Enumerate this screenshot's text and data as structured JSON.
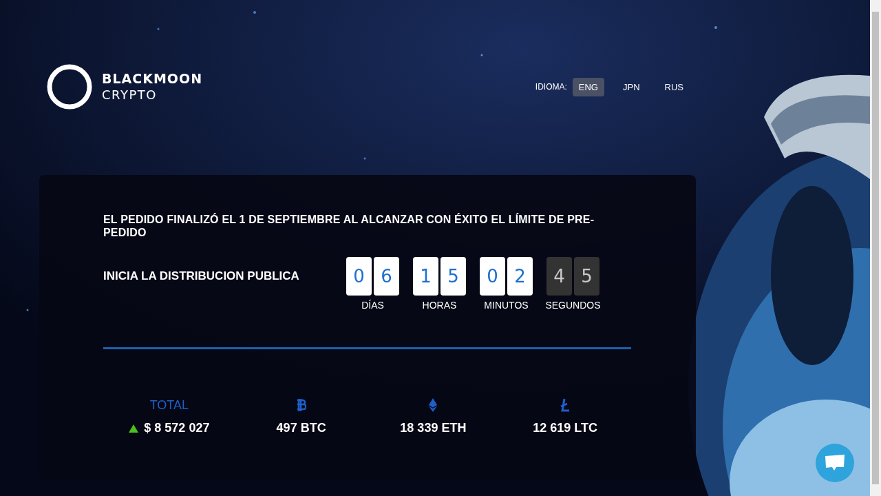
{
  "logo": {
    "line1": "BLACKMOON",
    "line2": "CRYPTO"
  },
  "language": {
    "label": "IDIOMA:",
    "options": [
      {
        "label": "ENG",
        "selected": true
      },
      {
        "label": "JPN",
        "selected": false
      },
      {
        "label": "RUS",
        "selected": false
      }
    ]
  },
  "notice": "EL PEDIDO FINALIZÓ EL 1 DE SEPTIEMBRE AL ALCANZAR CON ÉXITO EL LÍMITE DE PRE-PEDIDO",
  "countdown": {
    "label": "INICIA LA DISTRIBUCION PUBLICA",
    "units": [
      {
        "digits": [
          "0",
          "6"
        ],
        "label": "DÍAS",
        "kind": "light"
      },
      {
        "digits": [
          "1",
          "5"
        ],
        "label": "HORAS",
        "kind": "light"
      },
      {
        "digits": [
          "0",
          "2"
        ],
        "label": "MINUTOS",
        "kind": "light"
      },
      {
        "digits": [
          "4",
          "5"
        ],
        "label": "SEGUNDOS",
        "kind": "dark"
      }
    ]
  },
  "totals": [
    {
      "kind": "total",
      "heading": "TOTAL",
      "value": "$ 8 572 027",
      "rising": true
    },
    {
      "kind": "btc",
      "value": "497 BTC"
    },
    {
      "kind": "eth",
      "value": "18 339 ETH"
    },
    {
      "kind": "ltc",
      "value": "12 619 LTC"
    }
  ]
}
